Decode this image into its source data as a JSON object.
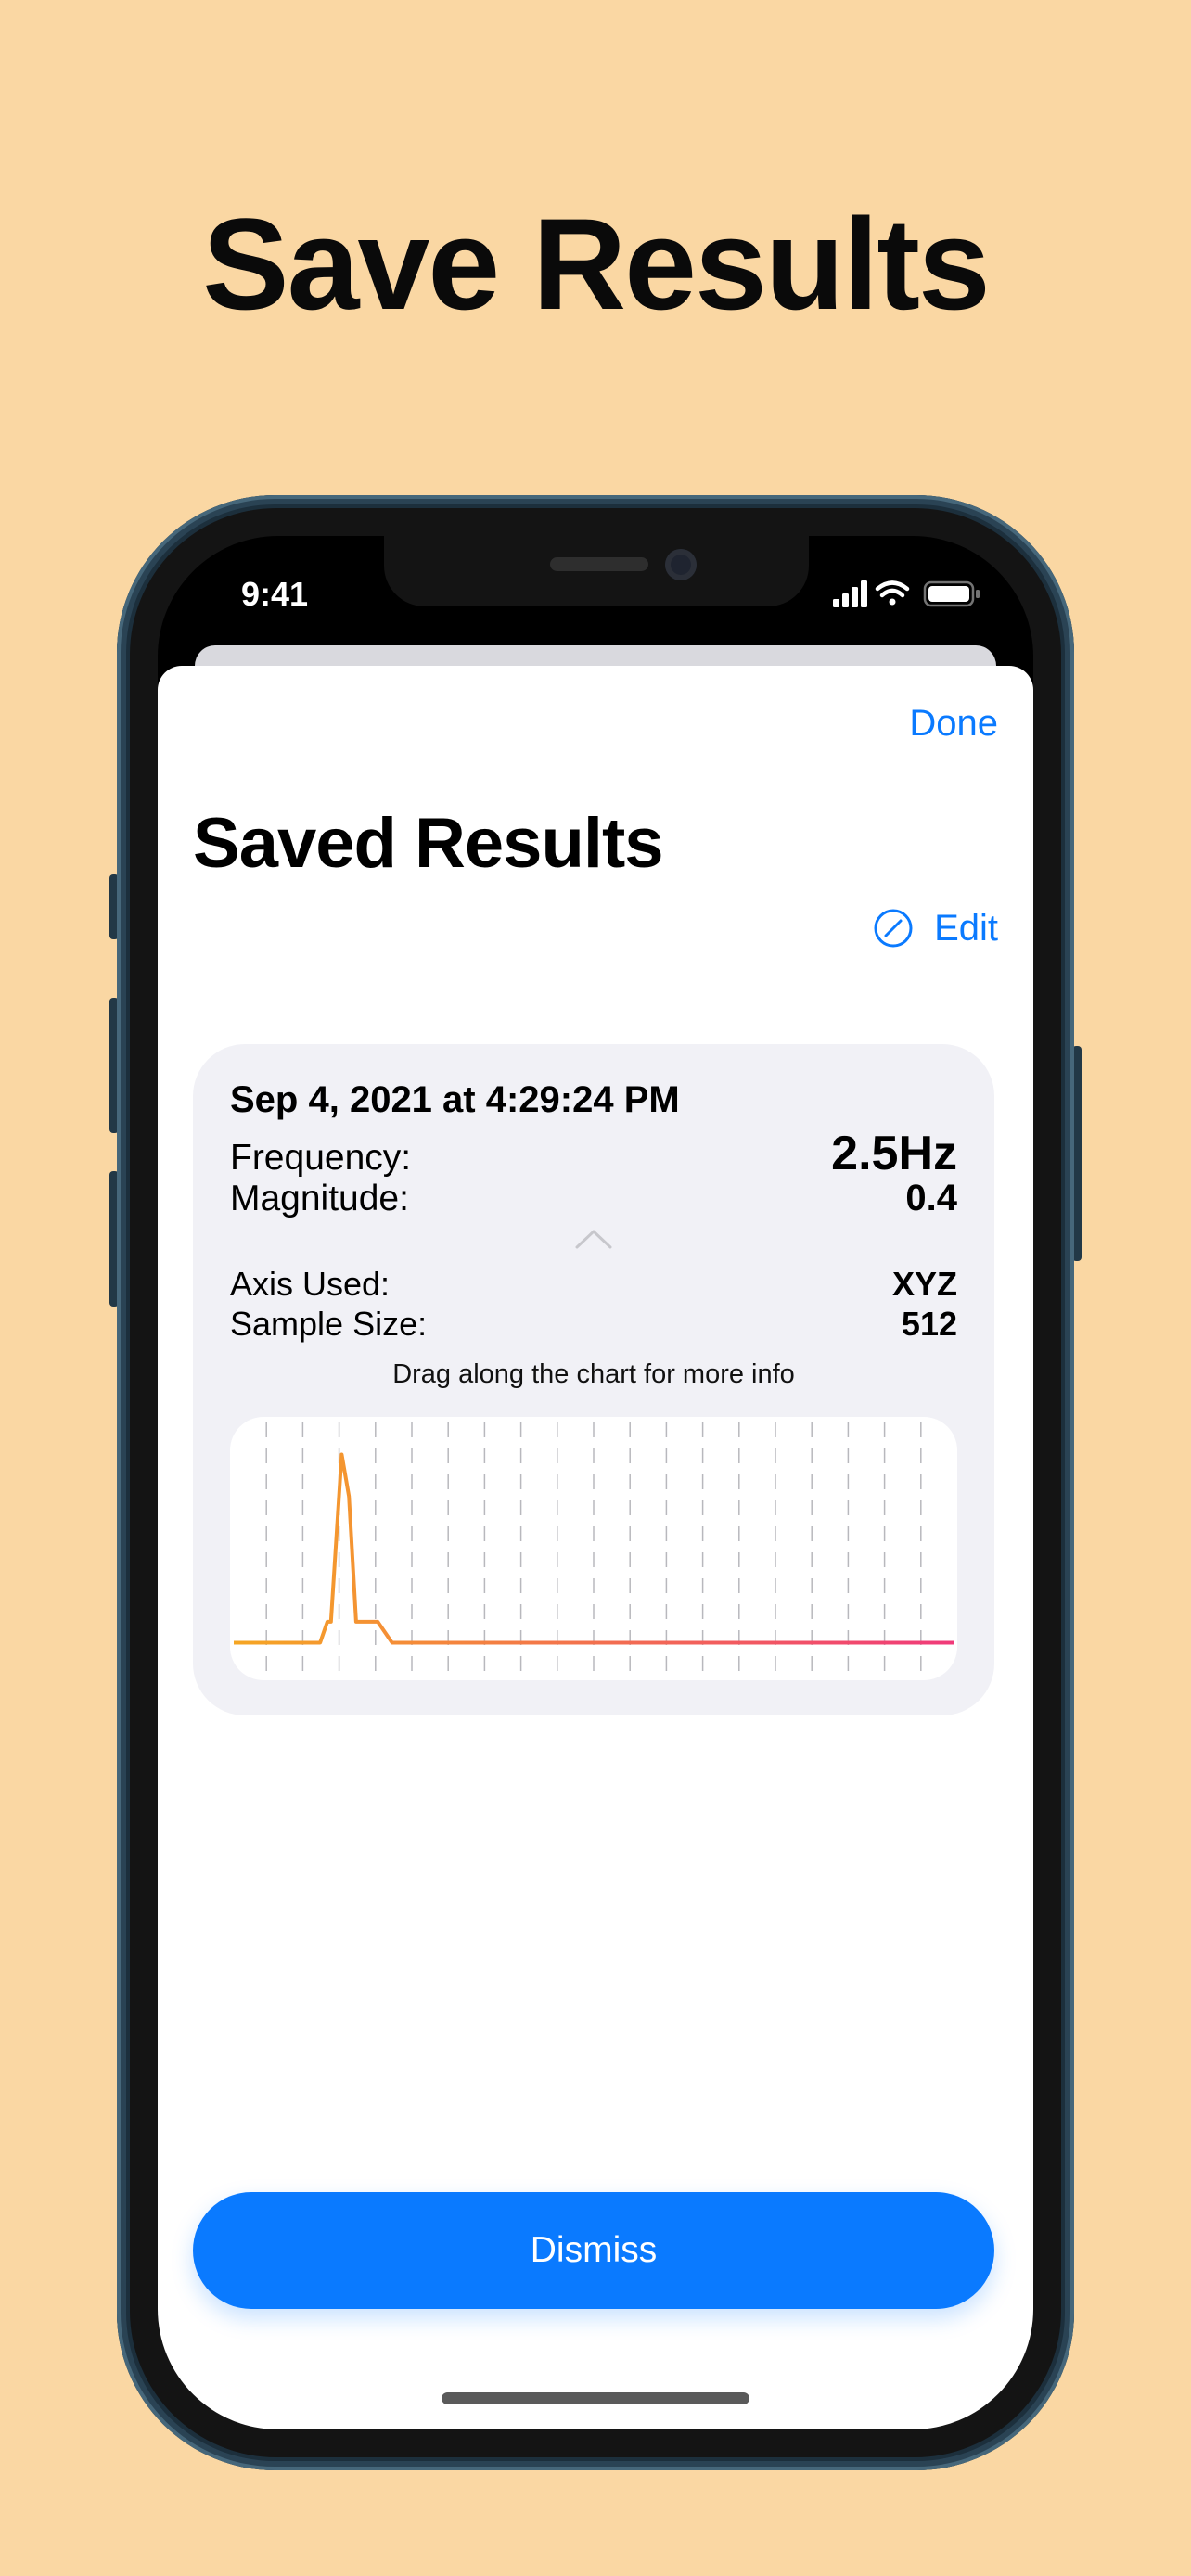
{
  "headline": "Save Results",
  "status_bar": {
    "time": "9:41"
  },
  "sheet": {
    "done_label": "Done",
    "title": "Saved Results",
    "edit_label": "Edit"
  },
  "result": {
    "date": "Sep 4, 2021 at 4:29:24 PM",
    "frequency_label": "Frequency:",
    "frequency_value": "2.5Hz",
    "magnitude_label": "Magnitude:",
    "magnitude_value": "0.4",
    "axis_label": "Axis Used:",
    "axis_value": "XYZ",
    "sample_size_label": "Sample Size:",
    "sample_size_value": "512",
    "hint": "Drag along the chart for more info"
  },
  "chart_data": {
    "type": "line",
    "x": [
      0,
      0.08,
      0.12,
      0.13,
      0.135,
      0.15,
      0.16,
      0.17,
      0.2,
      0.22,
      0.25,
      0.27,
      0.3,
      0.35,
      0.4,
      0.5,
      0.6,
      0.7,
      0.8,
      0.9,
      1.0
    ],
    "values": [
      0.1,
      0.1,
      0.1,
      0.2,
      0.2,
      1.0,
      0.8,
      0.2,
      0.2,
      0.1,
      0.1,
      0.1,
      0.1,
      0.1,
      0.1,
      0.1,
      0.1,
      0.1,
      0.1,
      0.1,
      0.1
    ],
    "ylim": [
      0,
      1.1
    ],
    "xlim": [
      0,
      1
    ],
    "grid": true,
    "gradient_colors": [
      "#F5A623",
      "#F03A7A"
    ]
  },
  "dismiss_label": "Dismiss",
  "colors": {
    "background": "#FAD7A3",
    "accent": "#0A7AFF",
    "card": "#F1F1F6"
  },
  "icons": {
    "edit": "pencil-circle-icon",
    "chevron": "chevron-up-icon"
  }
}
